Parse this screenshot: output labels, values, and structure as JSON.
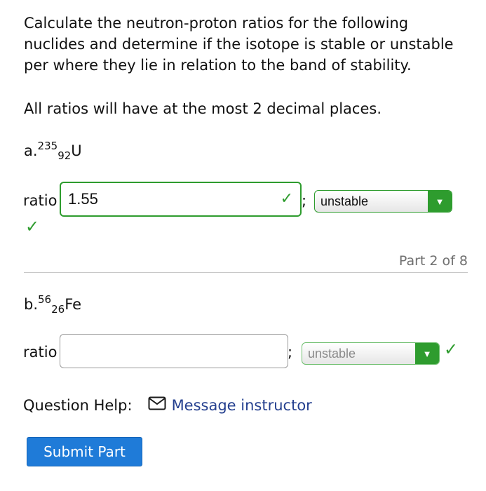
{
  "question": {
    "intro": "Calculate the neutron-proton ratios for the following nuclides and determine if the isotope is stable or unstable per where they lie in relation to the band of stability.",
    "note": "All ratios will have at the most 2 decimal places."
  },
  "part_a": {
    "prefix": "a.",
    "mass": "235",
    "atomic": "92",
    "symbol": "U",
    "ratio_label": "ratio",
    "ratio_value": "1.55",
    "separator": ";",
    "stability_value": "unstable"
  },
  "part_counter": "Part 2 of 8",
  "part_b": {
    "prefix": "b.",
    "mass": "56",
    "atomic": "26",
    "symbol": "Fe",
    "ratio_label": "ratio",
    "ratio_value": "",
    "separator": ";",
    "stability_value": "unstable"
  },
  "help": {
    "label": "Question Help:",
    "link": "Message instructor"
  },
  "submit_label": "Submit Part",
  "colors": {
    "correct": "#2e9c2e",
    "link": "#25408f",
    "button": "#1f7bd8"
  },
  "icons": {
    "check": "check-icon",
    "envelope": "envelope-icon",
    "dropdown": "triangle-down-icon"
  }
}
